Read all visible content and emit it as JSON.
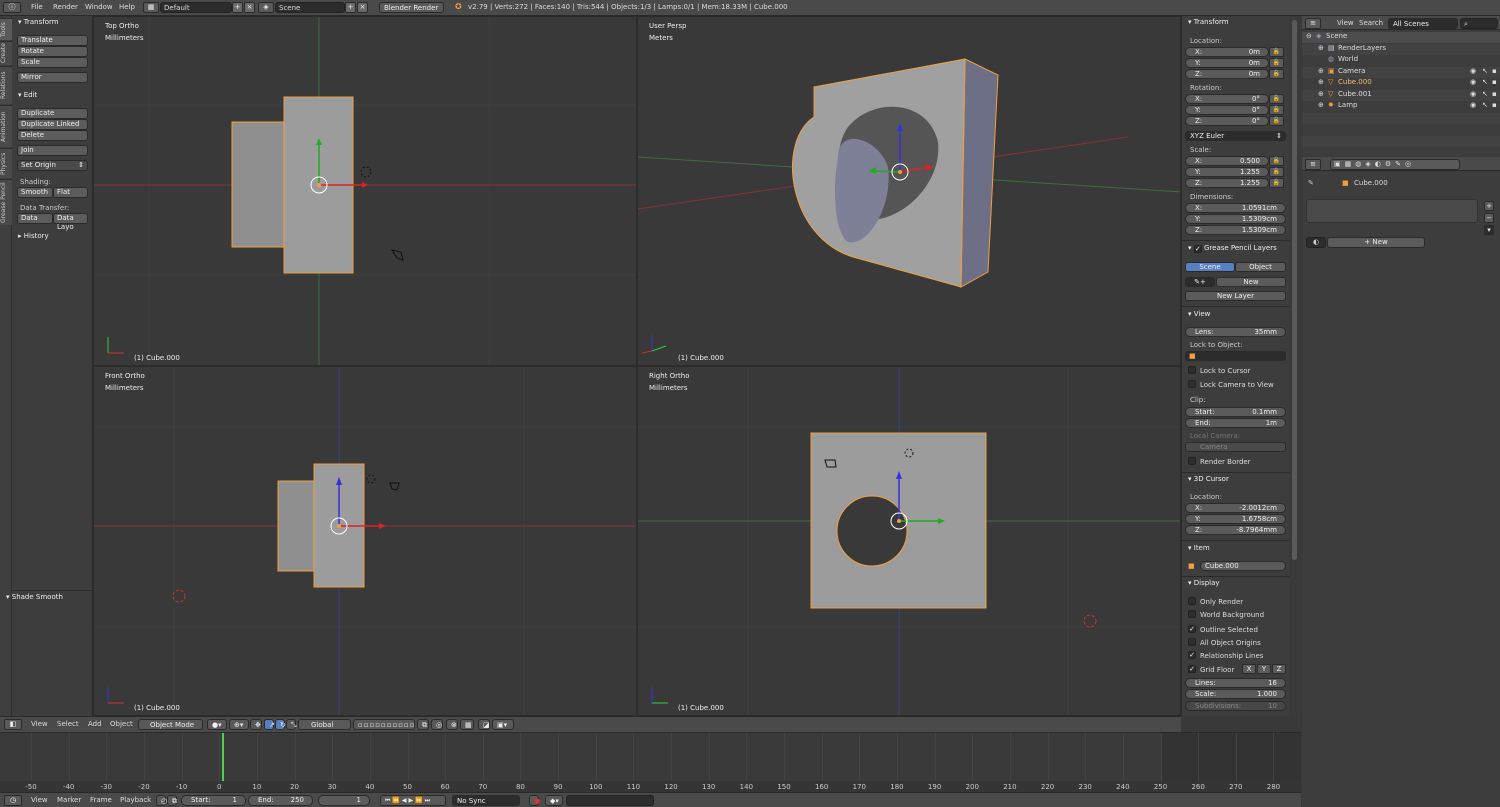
{
  "menubar": {
    "items": [
      "File",
      "Render",
      "Window",
      "Help"
    ],
    "screen_layout": "Default",
    "scene": "Scene",
    "render_engine": "Blender Render",
    "stats": "v2.79 | Verts:272 | Faces:140 | Tris:544 | Objects:1/3 | Lamps:0/1 | Mem:18.33M | Cube.000"
  },
  "tool_tabs": [
    "Tools",
    "Create",
    "Relations",
    "Animation",
    "Physics",
    "Grease Pencil"
  ],
  "tool_shelf": {
    "transform_header": "Transform",
    "translate": "Translate",
    "rotate": "Rotate",
    "scale": "Scale",
    "mirror": "Mirror",
    "edit_header": "Edit",
    "duplicate": "Duplicate",
    "duplicate_linked": "Duplicate Linked",
    "delete": "Delete",
    "join": "Join",
    "set_origin": "Set Origin",
    "shading_label": "Shading:",
    "smooth": "Smooth",
    "flat": "Flat",
    "data_transfer_label": "Data Transfer:",
    "data": "Data",
    "data_layout": "Data Layo",
    "history_header": "History",
    "operator_header": "Shade Smooth"
  },
  "viewports": {
    "top_left": {
      "title": "Top Ortho",
      "units": "Millimeters",
      "caption": "(1) Cube.000"
    },
    "top_right": {
      "title": "User Persp",
      "units": "Meters",
      "caption": "(1) Cube.000"
    },
    "bottom_left": {
      "title": "Front Ortho",
      "units": "Millimeters",
      "caption": "(1) Cube.000"
    },
    "bottom_right": {
      "title": "Right Ortho",
      "units": "Millimeters",
      "caption": "(1) Cube.000"
    }
  },
  "properties_panel": {
    "transform_header": "Transform",
    "location_label": "Location:",
    "location": {
      "x": "0m",
      "y": "0m",
      "z": "0m"
    },
    "rotation_label": "Rotation:",
    "rotation": {
      "x": "0°",
      "y": "0°",
      "z": "0°"
    },
    "rotation_mode": "XYZ Euler",
    "scale_label": "Scale:",
    "scale": {
      "x": "0.500",
      "y": "1.255",
      "z": "1.255"
    },
    "dimensions_label": "Dimensions:",
    "dimensions": {
      "x": "1.0591cm",
      "y": "1.5309cm",
      "z": "1.5309cm"
    },
    "axis_x": "X:",
    "axis_y": "Y:",
    "axis_z": "Z:",
    "grease_header": "Grease Pencil Layers",
    "scene_tab": "Scene",
    "object_tab": "Object",
    "new": "New",
    "new_layer": "New Layer",
    "view_header": "View",
    "lens_label": "Lens:",
    "lens_value": "35mm",
    "lock_to_object": "Lock to Object:",
    "lock_to_cursor": "Lock to Cursor",
    "lock_camera_to_view": "Lock Camera to View",
    "clip_label": "Clip:",
    "clip_start_label": "Start:",
    "clip_start": "0.1mm",
    "clip_end_label": "End:",
    "clip_end": "1m",
    "local_camera_label": "Local Camera:",
    "local_camera": "Camera",
    "render_border": "Render Border",
    "cursor_header": "3D Cursor",
    "cursor_location_label": "Location:",
    "cursor": {
      "x": "-2.0012cm",
      "y": "1.6758cm",
      "z": "-8.7964mm"
    },
    "item_header": "Item",
    "item_name": "Cube.000",
    "display_header": "Display",
    "only_render": "Only Render",
    "world_background": "World Background",
    "outline_selected": "Outline Selected",
    "all_object_origins": "All Object Origins",
    "relationship_lines": "Relationship Lines",
    "grid_floor": "Grid Floor",
    "grid_x": "X",
    "grid_y": "Y",
    "grid_z": "Z",
    "lines_label": "Lines:",
    "lines": "16",
    "grid_scale_label": "Scale:",
    "grid_scale": "1.000",
    "subdivisions_label": "Subdivisions:",
    "subdivisions": "10"
  },
  "outliner": {
    "view": "View",
    "search": "Search",
    "filter": "All Scenes",
    "rows": [
      "Scene",
      "RenderLayers",
      "World",
      "Camera",
      "Cube.000",
      "Cube.001",
      "Lamp"
    ]
  },
  "properties_editor": {
    "breadcrumb": "Cube.000",
    "new": "New"
  },
  "viewport_header": {
    "view": "View",
    "select": "Select",
    "add": "Add",
    "object": "Object",
    "mode": "Object Mode",
    "orientation": "Global"
  },
  "timeline": {
    "ticks": [
      "-50",
      "-40",
      "-30",
      "-20",
      "-10",
      "0",
      "10",
      "20",
      "30",
      "40",
      "50",
      "60",
      "70",
      "80",
      "90",
      "100",
      "110",
      "120",
      "130",
      "140",
      "150",
      "160",
      "170",
      "180",
      "190",
      "200",
      "210",
      "220",
      "230",
      "240",
      "250",
      "260",
      "270",
      "280"
    ],
    "current_frame_value": 1,
    "range_end_value": 250
  },
  "timeline_header": {
    "view": "View",
    "marker": "Marker",
    "frame": "Frame",
    "playback": "Playback",
    "start_label": "Start:",
    "start": "1",
    "end_label": "End:",
    "end": "250",
    "current": "1",
    "sync": "No Sync"
  },
  "colors": {
    "accent_blue": "#5680c2",
    "selection_orange": "#f0a040",
    "axis_red": "#c83232",
    "axis_green": "#3ca03c",
    "axis_blue": "#3a4fd0",
    "mesh_gray": "#a6a6a6",
    "playhead_green": "#4fd14f"
  }
}
